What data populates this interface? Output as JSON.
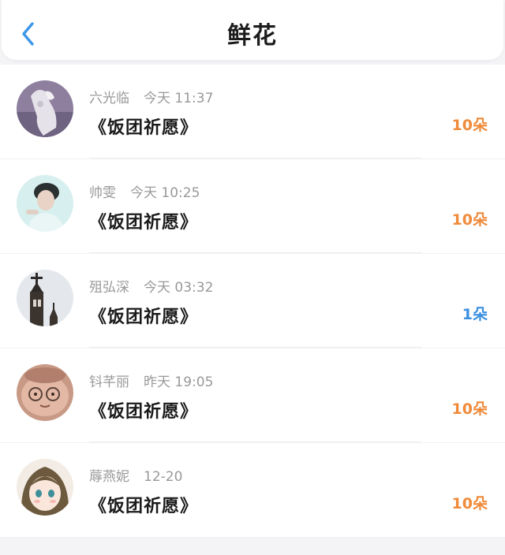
{
  "header": {
    "title": "鲜花",
    "back_icon": "chevron-left-icon",
    "accent_color": "#3b97e8"
  },
  "colors": {
    "count_orange": "#ef8a3a",
    "count_blue": "#3a8fe0",
    "meta_gray": "#999999"
  },
  "items": [
    {
      "name": "六光临",
      "time": "今天 11:37",
      "subject": "《饭团祈愿》",
      "count": "10朵",
      "count_color": "#ef8a3a",
      "avatar": "sculpture-avatar"
    },
    {
      "name": "帅雯",
      "time": "今天 10:25",
      "subject": "《饭团祈愿》",
      "count": "10朵",
      "count_color": "#ef8a3a",
      "avatar": "boy-portrait-avatar"
    },
    {
      "name": "殂弘深",
      "time": "今天 03:32",
      "subject": "《饭团祈愿》",
      "count": "1朵",
      "count_color": "#3a8fe0",
      "avatar": "church-tower-avatar"
    },
    {
      "name": "钭芊丽",
      "time": "昨天 19:05",
      "subject": "《饭团祈愿》",
      "count": "10朵",
      "count_color": "#ef8a3a",
      "avatar": "cartoon-face-avatar"
    },
    {
      "name": "蓐燕妮",
      "time": "12-20",
      "subject": "《饭团祈愿》",
      "count": "10朵",
      "count_color": "#ef8a3a",
      "avatar": "anime-girl-avatar"
    }
  ]
}
